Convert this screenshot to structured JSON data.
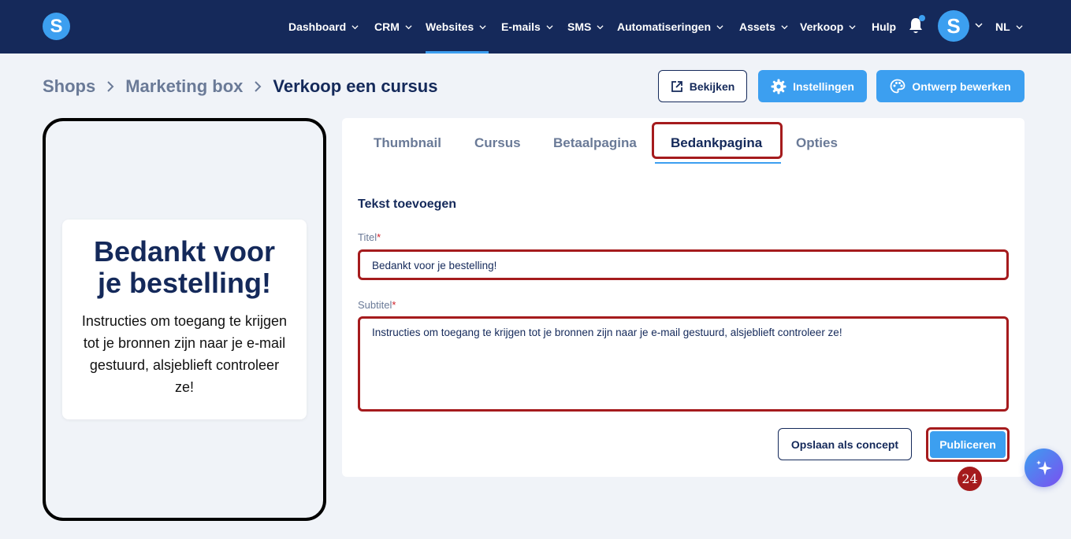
{
  "app": {
    "logo_letter": "S",
    "avatar_letter": "S"
  },
  "nav": {
    "items": [
      {
        "label": "Dashboard",
        "has_menu": true
      },
      {
        "label": "CRM",
        "has_menu": true
      },
      {
        "label": "Websites",
        "has_menu": true,
        "active": true
      },
      {
        "label": "E-mails",
        "has_menu": true
      },
      {
        "label": "SMS",
        "has_menu": true
      },
      {
        "label": "Automatiseringen",
        "has_menu": true
      },
      {
        "label": "Assets",
        "has_menu": true
      },
      {
        "label": "Verkoop",
        "has_menu": true
      },
      {
        "label": "Hulp",
        "has_menu": false
      }
    ],
    "language": "NL"
  },
  "breadcrumb": {
    "items": [
      "Shops",
      "Marketing box",
      "Verkoop een cursus"
    ]
  },
  "header_actions": {
    "view_label": "Bekijken",
    "settings_label": "Instellingen",
    "design_label": "Ontwerp bewerken"
  },
  "preview": {
    "title": "Bedankt voor je bestelling!",
    "subtitle": "Instructies om toegang te krijgen tot je bronnen zijn naar je e-mail gestuurd, alsjeblieft controleer ze!"
  },
  "tabs": [
    {
      "label": "Thumbnail"
    },
    {
      "label": "Cursus"
    },
    {
      "label": "Betaalpagina"
    },
    {
      "label": "Bedankpagina",
      "active": true
    },
    {
      "label": "Opties"
    }
  ],
  "form": {
    "section_title": "Tekst toevoegen",
    "title_label": "Titel",
    "title_value": "Bedankt voor je bestelling!",
    "subtitle_label": "Subtitel",
    "subtitle_value": "Instructies om toegang te krijgen tot je bronnen zijn naar je e-mail gestuurd, alsjeblieft controleer ze!",
    "required_mark": "*",
    "save_draft_label": "Opslaan als concept",
    "publish_label": "Publiceren"
  },
  "step_badge": "24",
  "colors": {
    "nav_bg": "#15295a",
    "accent": "#3c9ff0",
    "highlight": "#a51b1d",
    "text_dark": "#14295a",
    "text_muted": "#6a7a97"
  }
}
